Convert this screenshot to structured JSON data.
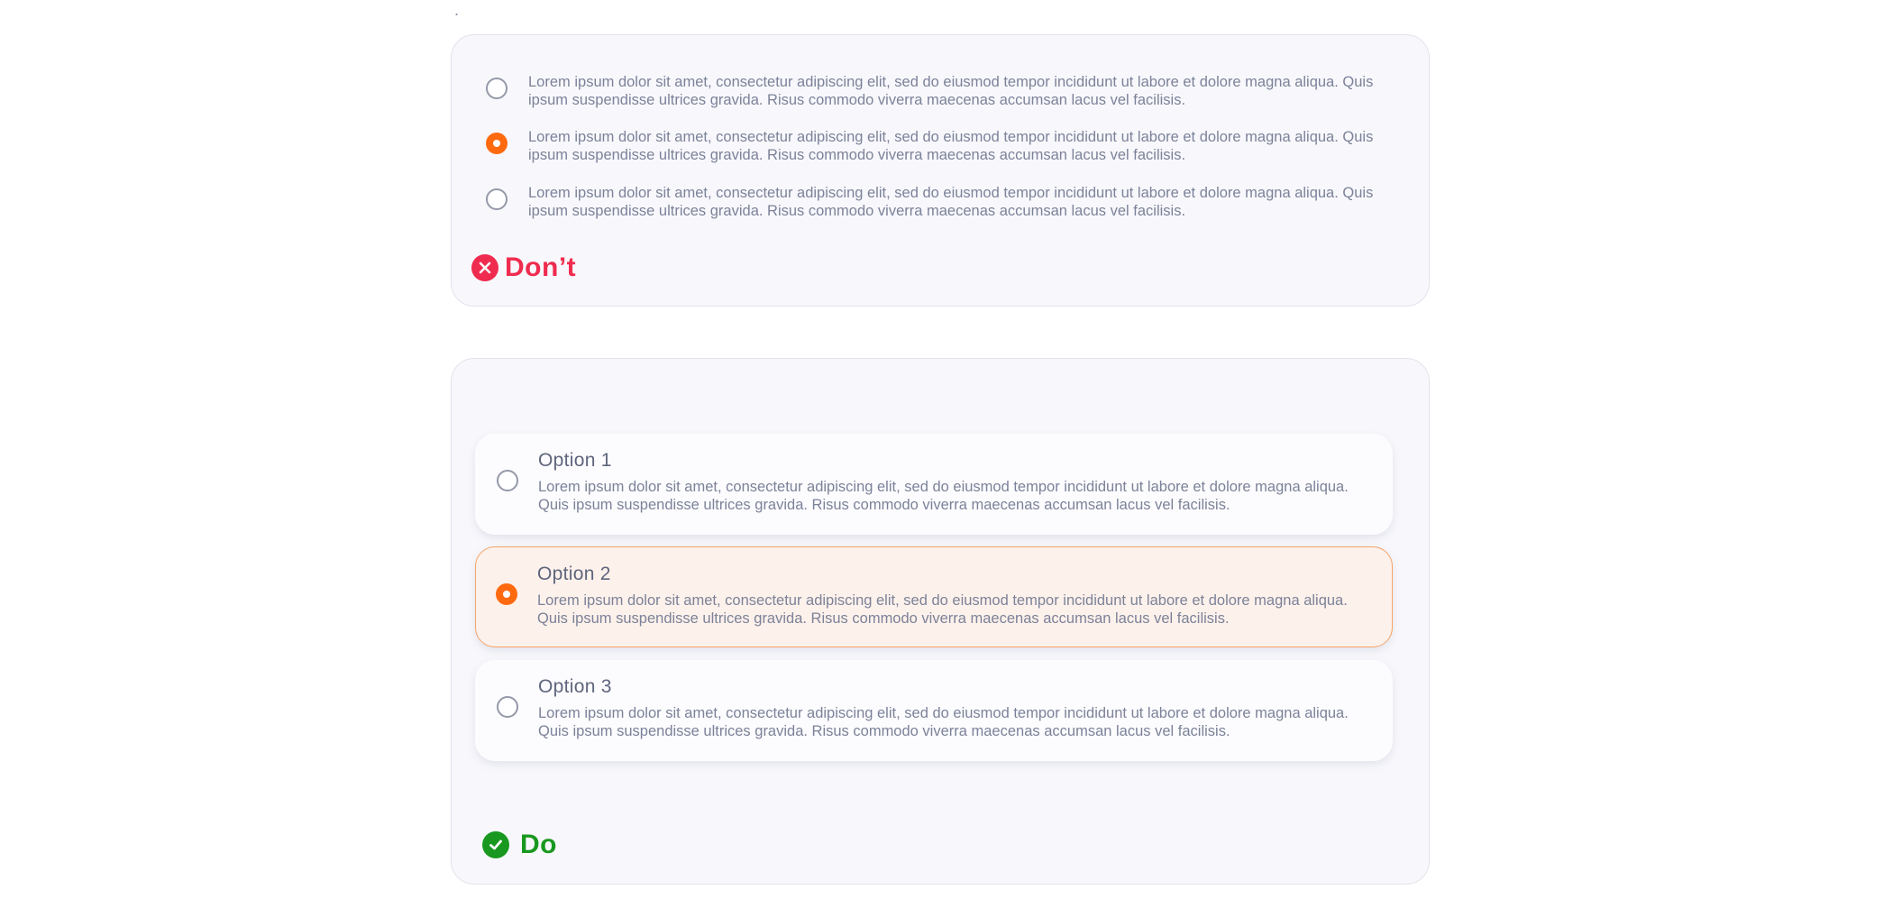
{
  "header": {
    "stray_mark": "."
  },
  "dont_example": {
    "options": [
      {
        "text": "Lorem ipsum dolor sit amet, consectetur adipiscing elit, sed do eiusmod tempor incididunt ut labore et dolore magna aliqua. Quis ipsum suspendisse ultrices gravida. Risus commodo viverra maecenas accumsan lacus vel facilisis.",
        "checked": false
      },
      {
        "text": "Lorem ipsum dolor sit amet, consectetur adipiscing elit, sed do eiusmod tempor incididunt ut labore et dolore magna aliqua. Quis ipsum suspendisse ultrices gravida. Risus commodo viverra maecenas accumsan lacus vel facilisis.",
        "checked": true
      },
      {
        "text": "Lorem ipsum dolor sit amet, consectetur adipiscing elit, sed do eiusmod tempor incididunt ut labore et dolore magna aliqua. Quis ipsum suspendisse ultrices gravida. Risus commodo viverra maecenas accumsan lacus vel facilisis.",
        "checked": false
      }
    ],
    "verdict_label": "Don’t",
    "verdict_icon": "close-circle-icon",
    "verdict_color": "#ef2c4f"
  },
  "do_example": {
    "options": [
      {
        "title": "Option 1",
        "description": "Lorem ipsum dolor sit amet, consectetur adipiscing elit, sed do eiusmod tempor incididunt ut labore et dolore magna aliqua. Quis ipsum suspendisse ultrices gravida. Risus commodo viverra maecenas accumsan lacus vel facilisis.",
        "checked": false
      },
      {
        "title": "Option 2",
        "description": "Lorem ipsum dolor sit amet, consectetur adipiscing elit, sed do eiusmod tempor incididunt ut labore et dolore magna aliqua. Quis ipsum suspendisse ultrices gravida. Risus commodo viverra maecenas accumsan lacus vel facilisis.",
        "checked": true
      },
      {
        "title": "Option 3",
        "description": "Lorem ipsum dolor sit amet, consectetur adipiscing elit, sed do eiusmod tempor incididunt ut labore et dolore magna aliqua. Quis ipsum suspendisse ultrices gravida. Risus commodo viverra maecenas accumsan lacus vel facilisis.",
        "checked": false
      }
    ],
    "verdict_label": "Do",
    "verdict_icon": "check-circle-icon",
    "verdict_color": "#19981f"
  },
  "colors": {
    "accent": "#ff6a0f",
    "selected_background": "#fdf1eb",
    "card_background": "#f8f8fc"
  }
}
